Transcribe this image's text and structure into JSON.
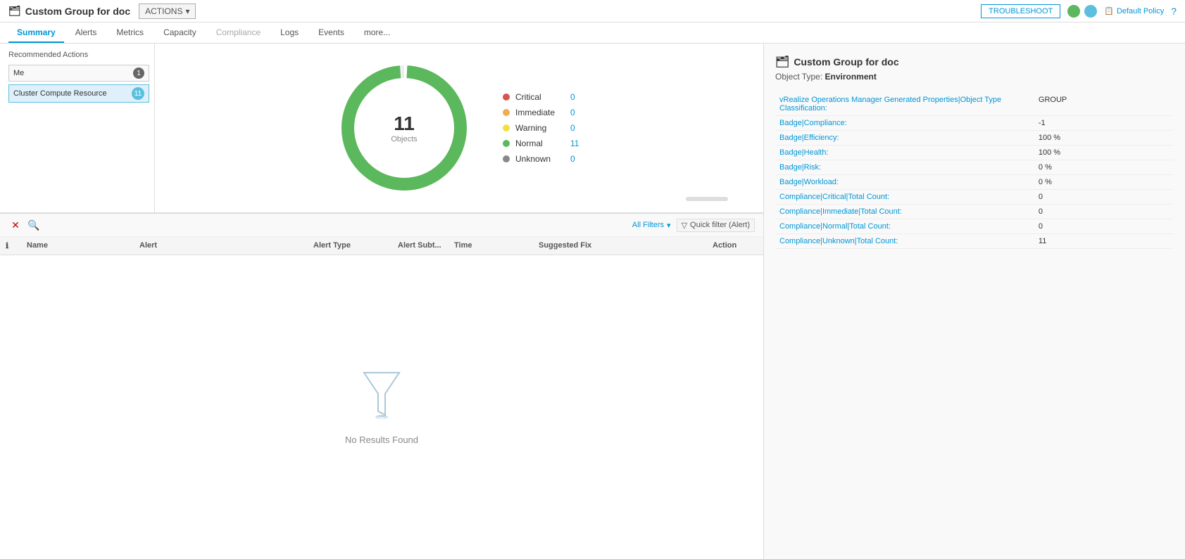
{
  "topBar": {
    "title": "Custom Group for doc",
    "actionsLabel": "ACTIONS",
    "troubleshootLabel": "TROUBLESHOOT",
    "defaultPolicyLabel": "Default Policy",
    "helpIcon": "?"
  },
  "tabs": [
    {
      "label": "Summary",
      "active": true,
      "disabled": false
    },
    {
      "label": "Alerts",
      "active": false,
      "disabled": false
    },
    {
      "label": "Metrics",
      "active": false,
      "disabled": false
    },
    {
      "label": "Capacity",
      "active": false,
      "disabled": false
    },
    {
      "label": "Compliance",
      "active": false,
      "disabled": true
    },
    {
      "label": "Logs",
      "active": false,
      "disabled": false
    },
    {
      "label": "Events",
      "active": false,
      "disabled": false
    },
    {
      "label": "more...",
      "active": false,
      "disabled": false
    }
  ],
  "recommendedActions": {
    "title": "Recommended Actions",
    "filters": [
      {
        "label": "Me",
        "count": "1",
        "type": "me"
      },
      {
        "label": "Cluster Compute Resource",
        "count": "11",
        "type": "cluster"
      }
    ]
  },
  "chart": {
    "totalObjects": "11",
    "objectsLabel": "Objects",
    "legend": [
      {
        "label": "Critical",
        "value": "0",
        "color": "#d9534f"
      },
      {
        "label": "Immediate",
        "value": "0",
        "color": "#f0ad4e"
      },
      {
        "label": "Warning",
        "value": "0",
        "color": "#f0e040"
      },
      {
        "label": "Normal",
        "value": "11",
        "color": "#5cb85c"
      },
      {
        "label": "Unknown",
        "value": "0",
        "color": "#888"
      }
    ]
  },
  "alertTable": {
    "allFiltersLabel": "All Filters",
    "quickFilterLabel": "Quick filter (Alert)",
    "columns": [
      "",
      "Name",
      "Alert",
      "Alert Type",
      "Alert Subt...",
      "Time",
      "Suggested Fix",
      "Action"
    ],
    "noResultsLabel": "No Results Found"
  },
  "rightPanel": {
    "title": "Custom Group for doc",
    "objectTypeLabel": "Object Type:",
    "objectTypeValue": "Environment",
    "properties": [
      {
        "label": "vRealize Operations Manager Generated Properties|Object Type Classification:",
        "value": "GROUP"
      },
      {
        "label": "Badge|Compliance:",
        "value": "-1"
      },
      {
        "label": "Badge|Efficiency:",
        "value": "100 %"
      },
      {
        "label": "Badge|Health:",
        "value": "100 %"
      },
      {
        "label": "Badge|Risk:",
        "value": "0 %"
      },
      {
        "label": "Badge|Workload:",
        "value": "0 %"
      },
      {
        "label": "Compliance|Critical|Total Count:",
        "value": "0"
      },
      {
        "label": "Compliance|Immediate|Total Count:",
        "value": "0"
      },
      {
        "label": "Compliance|Normal|Total Count:",
        "value": "0"
      },
      {
        "label": "Compliance|Unknown|Total Count:",
        "value": "11"
      }
    ]
  }
}
